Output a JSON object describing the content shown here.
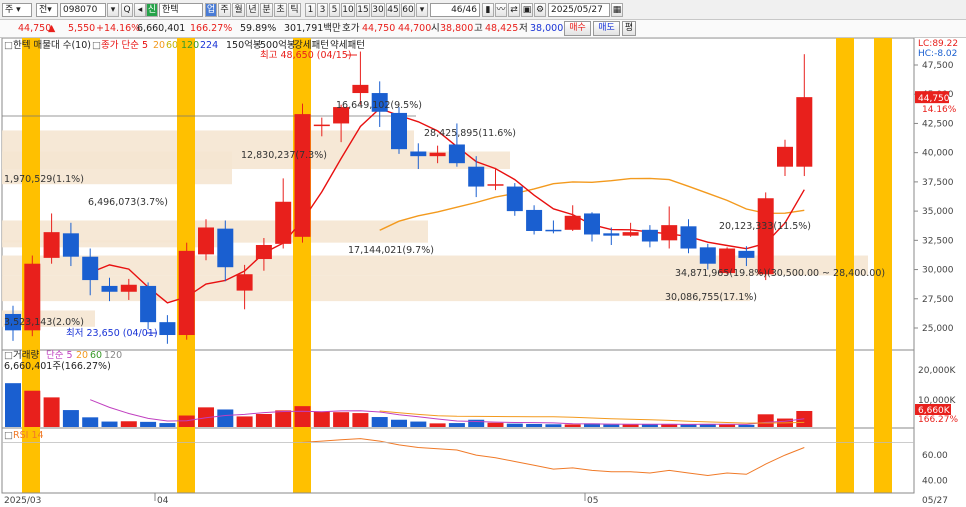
{
  "toolbar": {
    "market": "주",
    "code_label": "전",
    "code": "098070",
    "new_badge": "신",
    "name": "한텍",
    "favorite_badge": "업",
    "periods": [
      "주",
      "월",
      "년",
      "분",
      "초",
      "틱"
    ],
    "intervals": [
      "1",
      "3",
      "5",
      "10",
      "15",
      "30",
      "45",
      "60"
    ],
    "page": "46",
    "page_total": "/46",
    "date": "2025/05/27"
  },
  "quote": {
    "price": "44,750",
    "change": "5,550",
    "change_pct": "+14.16%",
    "volume": "6,660,401",
    "volume_ratio": "166.27%",
    "turnover_rate": "59.89%",
    "amount": "301,791백만",
    "ask_label": "호가",
    "ask": "44,750",
    "bid": "44,700",
    "open_label": "시",
    "open": "38,800",
    "high_label": "고",
    "high": "48,425",
    "low_label": "저",
    "low": "38,000",
    "buy_label": "매수",
    "sell_label": "매도",
    "eval_label": "평"
  },
  "colors": {
    "up": "#e8201c",
    "down": "#1a5fd0",
    "ma5": "#e81010",
    "ma20": "#f39a1e",
    "highlight": "#ffc000",
    "band": "#f5e6d2"
  },
  "chart_data": {
    "type": "candlestick",
    "legend": {
      "name": "한텍 매물대 수(10)",
      "ma_label": "종가 단순 5",
      "ma_periods": [
        "20",
        "60",
        "120",
        "224"
      ],
      "extra": [
        "150억봉",
        "500억봉",
        "강세패턴",
        "약세패턴"
      ]
    },
    "price_axis": {
      "ticks": [
        "47,500",
        "45,000",
        "42,500",
        "40,000",
        "37,500",
        "35,000",
        "32,500",
        "30,000",
        "27,500",
        "25,000"
      ],
      "lc": "LC:89.22",
      "hc": "HC:-8.02",
      "current": "44,750",
      "current_pct": "14.16%"
    },
    "annotations": {
      "max": "최고 48,650 (04/15)",
      "min": "최저 23,650 (04/01)"
    },
    "profile_labels": [
      "16,649,102(9.5%)",
      "28,425,895(11.6%)",
      "12,830,237(7.3%)",
      "1,970,529(1.1%)",
      "6,496,073(3.7%)",
      "17,144,021(9.7%)",
      "34,871,965(19.8%)(30,500.00 ~ 28,400.00)",
      "30,086,755(17.1%)",
      "3,523,143(2.0%)",
      "20,123,333(11.5%)"
    ],
    "candles": [
      [
        26200,
        24800,
        26900,
        23900
      ],
      [
        24800,
        30500,
        31200,
        24300
      ],
      [
        31000,
        33200,
        34800,
        30500
      ],
      [
        33100,
        31100,
        34000,
        30300
      ],
      [
        31100,
        29100,
        31800,
        27800
      ],
      [
        28600,
        28100,
        29300,
        27300
      ],
      [
        28100,
        28700,
        29200,
        27400
      ],
      [
        28600,
        25500,
        28900,
        24900
      ],
      [
        25500,
        24400,
        26100,
        23650
      ],
      [
        24400,
        31600,
        32300,
        24000
      ],
      [
        31300,
        33600,
        34300,
        30800
      ],
      [
        33500,
        30200,
        34200,
        29000
      ],
      [
        28200,
        29600,
        30400,
        26600
      ],
      [
        30900,
        32100,
        32700,
        29900
      ],
      [
        32200,
        35800,
        37800,
        31800
      ],
      [
        32800,
        43300,
        44200,
        32300
      ],
      [
        42400,
        42400,
        43000,
        41400
      ],
      [
        42500,
        43900,
        44100,
        40900
      ],
      [
        45100,
        45800,
        48650,
        44100
      ],
      [
        45100,
        43500,
        46100,
        42200
      ],
      [
        43400,
        40300,
        43900,
        39900
      ],
      [
        40100,
        39700,
        40800,
        38600
      ],
      [
        39700,
        40000,
        40600,
        39100
      ],
      [
        40700,
        39100,
        42500,
        38800
      ],
      [
        38800,
        37100,
        39700,
        36200
      ],
      [
        37300,
        37300,
        38700,
        36800
      ],
      [
        37100,
        35000,
        37400,
        34600
      ],
      [
        35100,
        33300,
        35500,
        33000
      ],
      [
        33400,
        33300,
        34200,
        33100
      ],
      [
        33400,
        34600,
        35500,
        33300
      ],
      [
        34800,
        33000,
        34900,
        32400
      ],
      [
        33100,
        32900,
        33600,
        32100
      ],
      [
        32900,
        33200,
        34000,
        32800
      ],
      [
        33400,
        32400,
        33800,
        31900
      ],
      [
        32500,
        33800,
        35400,
        31800
      ],
      [
        33700,
        31800,
        34300,
        31400
      ],
      [
        31900,
        30500,
        32200,
        30000
      ],
      [
        29700,
        31800,
        31900,
        29600
      ],
      [
        31600,
        31000,
        32000,
        30300
      ],
      [
        29600,
        36100,
        36600,
        29100
      ],
      [
        38800,
        40500,
        41100,
        38000
      ],
      [
        38800,
        44750,
        48425,
        38000
      ]
    ],
    "volume_panel": {
      "label": "거래량",
      "ma_label": "단순 5",
      "ma_periods": [
        "20",
        "60",
        "120"
      ],
      "value": "6,660,401주(166.27%)",
      "ticks": [
        "20,000K",
        "10,000K"
      ],
      "current": "6,660K",
      "current_pct": "166.27%",
      "values": [
        14500,
        12000,
        9800,
        5600,
        3200,
        1800,
        1900,
        1700,
        1300,
        3800,
        6500,
        5800,
        3500,
        4300,
        5500,
        6900,
        5100,
        4900,
        4600,
        3300,
        2400,
        1800,
        1200,
        1300,
        2400,
        1400,
        1100,
        1000,
        900,
        850,
        1200,
        800,
        800,
        850,
        850,
        950,
        1000,
        800,
        700,
        4200,
        2800,
        5300
      ]
    },
    "rsi_panel": {
      "label": "RSI 14",
      "ticks": [
        "60.00",
        "40.00"
      ]
    },
    "x_labels": [
      "2025/03",
      "04",
      "05",
      "05/27"
    ]
  }
}
